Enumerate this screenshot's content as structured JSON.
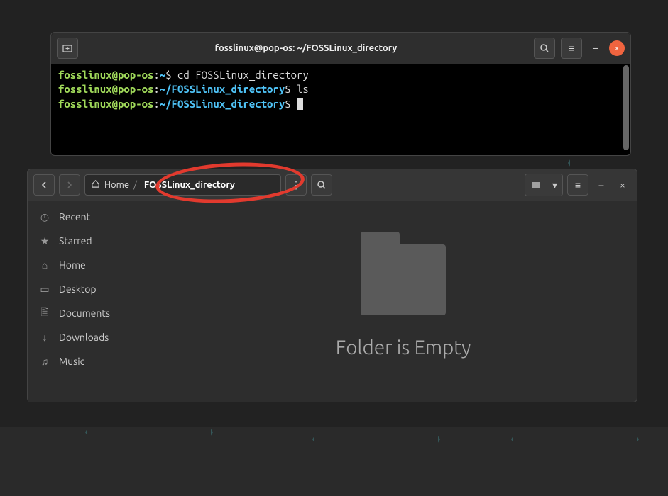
{
  "terminal": {
    "title": "fosslinux@pop-os: ~/FOSSLinux_directory",
    "lines": [
      {
        "user": "fosslinux@pop-os",
        "path": "~",
        "cmd": "cd FOSSLinux_directory"
      },
      {
        "user": "fosslinux@pop-os",
        "path": "~/FOSSLinux_directory",
        "cmd": "ls"
      },
      {
        "user": "fosslinux@pop-os",
        "path": "~/FOSSLinux_directory",
        "cmd": ""
      }
    ]
  },
  "files": {
    "breadcrumb": {
      "home": "Home",
      "current": "FOSSLinux_directory"
    },
    "empty_label": "Folder is Empty",
    "sidebar": [
      {
        "icon": "clock-icon",
        "glyph": "◷",
        "label": "Recent"
      },
      {
        "icon": "star-icon",
        "glyph": "★",
        "label": "Starred"
      },
      {
        "icon": "home-icon",
        "glyph": "⌂",
        "label": "Home"
      },
      {
        "icon": "desktop-icon",
        "glyph": "▭",
        "label": "Desktop"
      },
      {
        "icon": "documents-icon",
        "glyph": "🗎",
        "label": "Documents"
      },
      {
        "icon": "downloads-icon",
        "glyph": "↓",
        "label": "Downloads"
      },
      {
        "icon": "music-icon",
        "glyph": "♫",
        "label": "Music"
      }
    ]
  }
}
